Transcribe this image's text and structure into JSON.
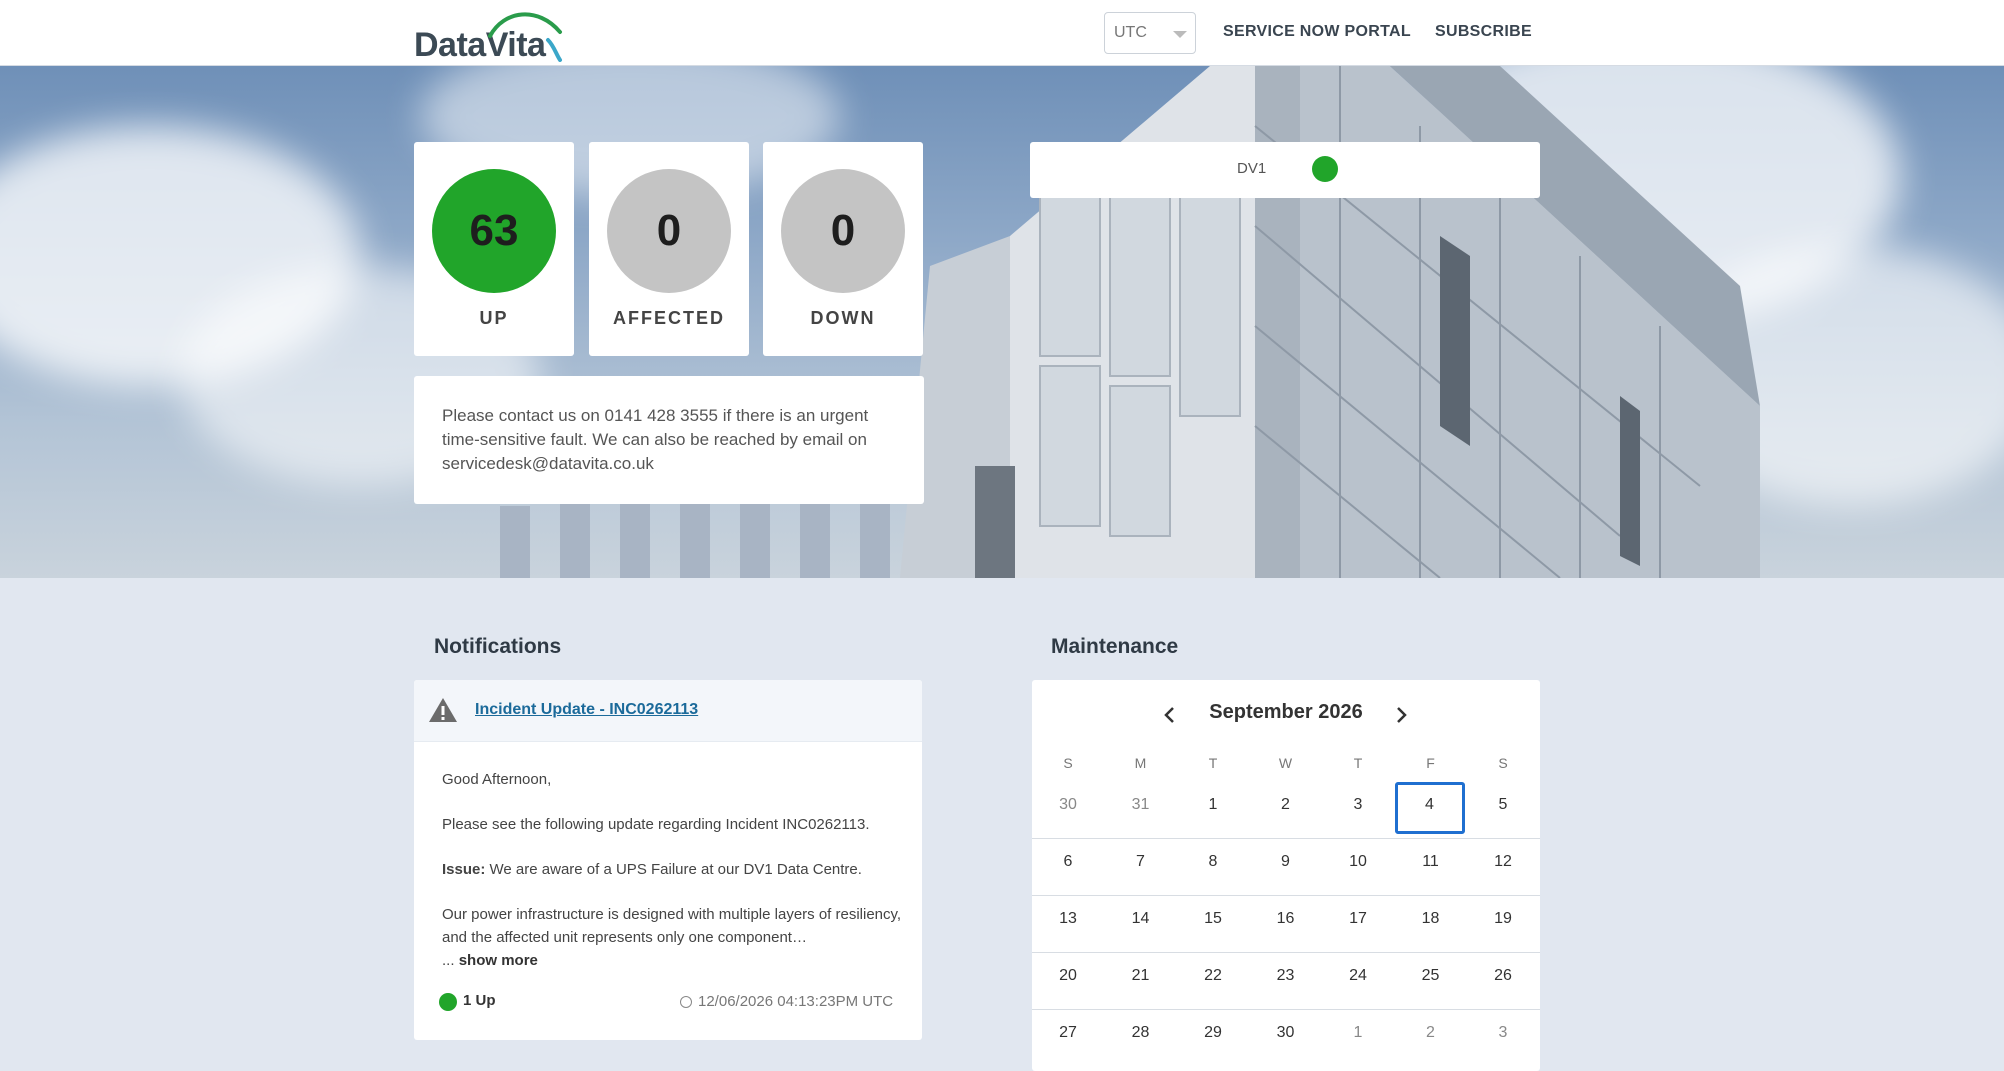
{
  "header": {
    "logo_text": "DataVita",
    "timezone": "UTC",
    "nav": [
      "SERVICE NOW PORTAL",
      "SUBSCRIBE"
    ]
  },
  "colors": {
    "up": "#21a52a",
    "neutral": "#c4c4c4",
    "link": "#1b6a9a",
    "selected": "#1f6fd0"
  },
  "stats": [
    {
      "value": "63",
      "label": "UP"
    },
    {
      "value": "0",
      "label": "AFFECTED"
    },
    {
      "value": "0",
      "label": "DOWN"
    }
  ],
  "contact": {
    "text": "Please contact us on 0141 428 3555 if there is an urgent time-sensitive fault. We can also be reached by email on servicedesk@datavita.co.uk"
  },
  "sites": [
    {
      "name": "DV1",
      "status": "up"
    }
  ],
  "notifications": {
    "title": "Notifications",
    "items": [
      {
        "icon": "warning-icon",
        "title": "Incident Update - INC0262113 ",
        "greeting": "Good Afternoon,",
        "intro": "Please see the following update regarding Incident INC0262113.",
        "issue_label": "Issue:",
        "issue_text": " We are aware of a UPS Failure at our DV1 Data Centre.",
        "excerpt": "Our power infrastructure is designed with multiple layers of resiliency, and the affected unit represents only one component…",
        "ellipsis": "...",
        "show_more": "show more",
        "status": "1 Up",
        "timestamp": "12/06/2026 04:13:23PM UTC"
      }
    ]
  },
  "maintenance": {
    "title": "Maintenance",
    "month": "September 2026",
    "weekdays": [
      "S",
      "M",
      "T",
      "W",
      "T",
      "F",
      "S"
    ],
    "weeks": [
      [
        "30",
        "31",
        "1",
        "2",
        "3",
        "4",
        "5"
      ],
      [
        "6",
        "7",
        "8",
        "9",
        "10",
        "11",
        "12"
      ],
      [
        "13",
        "14",
        "15",
        "16",
        "17",
        "18",
        "19"
      ],
      [
        "20",
        "21",
        "22",
        "23",
        "24",
        "25",
        "26"
      ],
      [
        "27",
        "28",
        "29",
        "30",
        "1",
        "2",
        "3"
      ]
    ]
  }
}
